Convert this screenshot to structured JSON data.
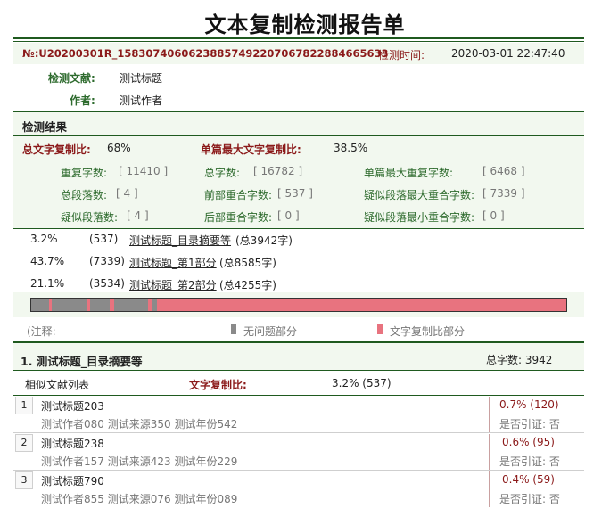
{
  "title": "文本复制检测报告单",
  "report": {
    "number": "№:U20200301R_1583074060623885749220706782288466563​3",
    "time_label": "检测时间:",
    "time_value": "2020-03-01 22:47:40",
    "doc_label": "检测文献:",
    "doc_value": "测试标题",
    "author_label": "作者:",
    "author_value": "测试作者"
  },
  "results": {
    "section_title": "检测结果",
    "total_ratio_label": "总文字复制比:",
    "total_ratio_value": "68%",
    "max_ratio_label": "单篇最大文字复制比:",
    "max_ratio_value": "38.5%",
    "stats": [
      {
        "label": "重复字数:",
        "value": "[ 11410 ]"
      },
      {
        "label": "总字数:",
        "value": "[ 16782 ]"
      },
      {
        "label": "单篇最大重复字数:",
        "value": "[ 6468 ]"
      },
      {
        "label": "总段落数:",
        "value": "[ 4 ]"
      },
      {
        "label": "前部重合字数:",
        "value": "[ 537 ]"
      },
      {
        "label": "疑似段落最大重合字数:",
        "value": "[ 7339 ]"
      },
      {
        "label": "疑似段落数:",
        "value": "[ 4 ]"
      },
      {
        "label": "后部重合字数:",
        "value": "[ 0 ]"
      },
      {
        "label": "疑似段落最小重合字数:",
        "value": "[ 0 ]"
      }
    ]
  },
  "sections": [
    {
      "pct": "3.2%",
      "count": "(537)",
      "name": "测试标题_目录摘要等",
      "total": "(总3942字)"
    },
    {
      "pct": "43.7%",
      "count": "(7339)",
      "name": "测试标题_第1部分",
      "total": "(总8585字)"
    },
    {
      "pct": "21.1%",
      "count": "(3534)",
      "name": "测试标题_第2部分",
      "total": "(总4255字)"
    }
  ],
  "legend": {
    "note": "(注释:",
    "ok_label": "无问题部分",
    "ok_color": "#8a8a8a",
    "dup_label": "文字复制比部分",
    "dup_color": "#e8737f"
  },
  "detail": {
    "heading": "1. 测试标题_目录摘要等",
    "total_words": "总字数:  3942",
    "similar_list_label": "相似文献列表",
    "ratio_label": "文字复制比:",
    "ratio_value": "3.2%  (537)",
    "items": [
      {
        "num": "1",
        "title": "测试标题203",
        "meta": "测试作者080 测试来源350 测试年份542",
        "ratio": "0.7%  (120)",
        "cite": "是否引证: 否"
      },
      {
        "num": "2",
        "title": "测试标题238",
        "meta": "测试作者157 测试来源423 测试年份229",
        "ratio": "0.6%  (95)",
        "cite": "是否引证: 否"
      },
      {
        "num": "3",
        "title": "测试标题790",
        "meta": "测试作者855 测试来源076 测试年份089",
        "ratio": "0.4%  (59)",
        "cite": "是否引证: 否"
      }
    ]
  }
}
